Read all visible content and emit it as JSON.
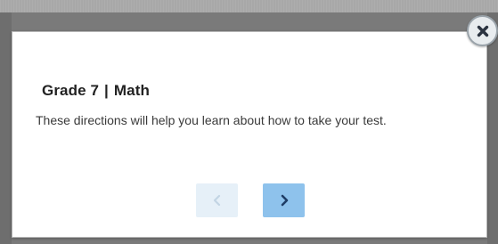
{
  "dialog": {
    "title_grade": "Grade 7",
    "title_separator": "|",
    "title_subject": "Math",
    "body": "These directions will help you learn about how to take your test."
  },
  "navigation": {
    "previous_icon": "chevron-left-icon",
    "next_icon": "chevron-right-icon",
    "previous_enabled": false,
    "next_enabled": true
  },
  "close": {
    "icon": "close-icon"
  },
  "colors": {
    "backdrop": "#7a7a7a",
    "dialog_background": "#ffffff",
    "next_button": "#8ec2ec",
    "previous_button_disabled": "#e6f0f8",
    "next_chevron": "#1f3d66",
    "previous_chevron": "#c3d5e4",
    "close_icon": "#2b3340"
  }
}
